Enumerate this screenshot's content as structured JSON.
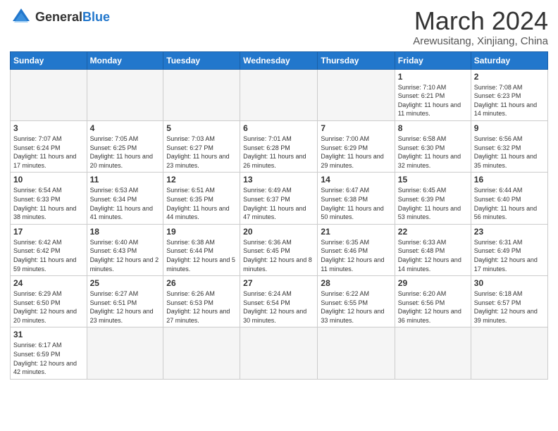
{
  "header": {
    "logo_general": "General",
    "logo_blue": "Blue",
    "title": "March 2024",
    "location": "Arewusitang, Xinjiang, China"
  },
  "days_of_week": [
    "Sunday",
    "Monday",
    "Tuesday",
    "Wednesday",
    "Thursday",
    "Friday",
    "Saturday"
  ],
  "weeks": [
    [
      {
        "day": "",
        "info": ""
      },
      {
        "day": "",
        "info": ""
      },
      {
        "day": "",
        "info": ""
      },
      {
        "day": "",
        "info": ""
      },
      {
        "day": "",
        "info": ""
      },
      {
        "day": "1",
        "info": "Sunrise: 7:10 AM\nSunset: 6:21 PM\nDaylight: 11 hours and 11 minutes."
      },
      {
        "day": "2",
        "info": "Sunrise: 7:08 AM\nSunset: 6:23 PM\nDaylight: 11 hours and 14 minutes."
      }
    ],
    [
      {
        "day": "3",
        "info": "Sunrise: 7:07 AM\nSunset: 6:24 PM\nDaylight: 11 hours and 17 minutes."
      },
      {
        "day": "4",
        "info": "Sunrise: 7:05 AM\nSunset: 6:25 PM\nDaylight: 11 hours and 20 minutes."
      },
      {
        "day": "5",
        "info": "Sunrise: 7:03 AM\nSunset: 6:27 PM\nDaylight: 11 hours and 23 minutes."
      },
      {
        "day": "6",
        "info": "Sunrise: 7:01 AM\nSunset: 6:28 PM\nDaylight: 11 hours and 26 minutes."
      },
      {
        "day": "7",
        "info": "Sunrise: 7:00 AM\nSunset: 6:29 PM\nDaylight: 11 hours and 29 minutes."
      },
      {
        "day": "8",
        "info": "Sunrise: 6:58 AM\nSunset: 6:30 PM\nDaylight: 11 hours and 32 minutes."
      },
      {
        "day": "9",
        "info": "Sunrise: 6:56 AM\nSunset: 6:32 PM\nDaylight: 11 hours and 35 minutes."
      }
    ],
    [
      {
        "day": "10",
        "info": "Sunrise: 6:54 AM\nSunset: 6:33 PM\nDaylight: 11 hours and 38 minutes."
      },
      {
        "day": "11",
        "info": "Sunrise: 6:53 AM\nSunset: 6:34 PM\nDaylight: 11 hours and 41 minutes."
      },
      {
        "day": "12",
        "info": "Sunrise: 6:51 AM\nSunset: 6:35 PM\nDaylight: 11 hours and 44 minutes."
      },
      {
        "day": "13",
        "info": "Sunrise: 6:49 AM\nSunset: 6:37 PM\nDaylight: 11 hours and 47 minutes."
      },
      {
        "day": "14",
        "info": "Sunrise: 6:47 AM\nSunset: 6:38 PM\nDaylight: 11 hours and 50 minutes."
      },
      {
        "day": "15",
        "info": "Sunrise: 6:45 AM\nSunset: 6:39 PM\nDaylight: 11 hours and 53 minutes."
      },
      {
        "day": "16",
        "info": "Sunrise: 6:44 AM\nSunset: 6:40 PM\nDaylight: 11 hours and 56 minutes."
      }
    ],
    [
      {
        "day": "17",
        "info": "Sunrise: 6:42 AM\nSunset: 6:42 PM\nDaylight: 11 hours and 59 minutes."
      },
      {
        "day": "18",
        "info": "Sunrise: 6:40 AM\nSunset: 6:43 PM\nDaylight: 12 hours and 2 minutes."
      },
      {
        "day": "19",
        "info": "Sunrise: 6:38 AM\nSunset: 6:44 PM\nDaylight: 12 hours and 5 minutes."
      },
      {
        "day": "20",
        "info": "Sunrise: 6:36 AM\nSunset: 6:45 PM\nDaylight: 12 hours and 8 minutes."
      },
      {
        "day": "21",
        "info": "Sunrise: 6:35 AM\nSunset: 6:46 PM\nDaylight: 12 hours and 11 minutes."
      },
      {
        "day": "22",
        "info": "Sunrise: 6:33 AM\nSunset: 6:48 PM\nDaylight: 12 hours and 14 minutes."
      },
      {
        "day": "23",
        "info": "Sunrise: 6:31 AM\nSunset: 6:49 PM\nDaylight: 12 hours and 17 minutes."
      }
    ],
    [
      {
        "day": "24",
        "info": "Sunrise: 6:29 AM\nSunset: 6:50 PM\nDaylight: 12 hours and 20 minutes."
      },
      {
        "day": "25",
        "info": "Sunrise: 6:27 AM\nSunset: 6:51 PM\nDaylight: 12 hours and 23 minutes."
      },
      {
        "day": "26",
        "info": "Sunrise: 6:26 AM\nSunset: 6:53 PM\nDaylight: 12 hours and 27 minutes."
      },
      {
        "day": "27",
        "info": "Sunrise: 6:24 AM\nSunset: 6:54 PM\nDaylight: 12 hours and 30 minutes."
      },
      {
        "day": "28",
        "info": "Sunrise: 6:22 AM\nSunset: 6:55 PM\nDaylight: 12 hours and 33 minutes."
      },
      {
        "day": "29",
        "info": "Sunrise: 6:20 AM\nSunset: 6:56 PM\nDaylight: 12 hours and 36 minutes."
      },
      {
        "day": "30",
        "info": "Sunrise: 6:18 AM\nSunset: 6:57 PM\nDaylight: 12 hours and 39 minutes."
      }
    ],
    [
      {
        "day": "31",
        "info": "Sunrise: 6:17 AM\nSunset: 6:59 PM\nDaylight: 12 hours and 42 minutes."
      },
      {
        "day": "",
        "info": ""
      },
      {
        "day": "",
        "info": ""
      },
      {
        "day": "",
        "info": ""
      },
      {
        "day": "",
        "info": ""
      },
      {
        "day": "",
        "info": ""
      },
      {
        "day": "",
        "info": ""
      }
    ]
  ]
}
